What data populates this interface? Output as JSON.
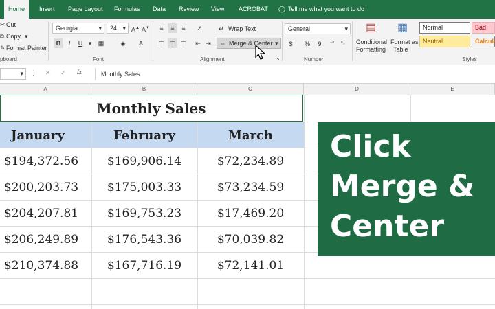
{
  "tabs": [
    "Home",
    "Insert",
    "Page Layout",
    "Formulas",
    "Data",
    "Review",
    "View",
    "ACROBAT"
  ],
  "tell_me": "Tell me what you want to do",
  "clipboard": {
    "cut": "Cut",
    "copy": "Copy",
    "format_painter": "Format Painter",
    "label": "pboard"
  },
  "font": {
    "name": "Georgia",
    "size": "24",
    "label": "Font",
    "bold": "B",
    "italic": "I",
    "underline": "U"
  },
  "alignment": {
    "wrap_text": "Wrap Text",
    "merge_center": "Merge & Center",
    "label": "Alignment"
  },
  "number": {
    "format": "General",
    "currency": "$",
    "percent": "%",
    "comma": "9",
    "label": "Number"
  },
  "styles_group": {
    "conditional_formatting": [
      "Conditional",
      "Formatting"
    ],
    "format_as_table": [
      "Format as",
      "Table"
    ],
    "label": "Styles",
    "normal": "Normal",
    "bad": "Bad",
    "neutral": "Neutral",
    "calculation": "Calcula"
  },
  "formula_bar": {
    "fx": "fx",
    "value": "Monthly Sales"
  },
  "columns": [
    "A",
    "B",
    "C",
    "D",
    "E"
  ],
  "sheet": {
    "title": "Monthly Sales",
    "headers": [
      "January",
      "February",
      "March"
    ],
    "rows": [
      [
        "$194,372.56",
        "$169,906.14",
        "$72,234.89"
      ],
      [
        "$200,203.73",
        "$175,003.33",
        "$73,234.59"
      ],
      [
        "$204,207.81",
        "$169,753.23",
        "$17,469.20"
      ],
      [
        "$206,249.89",
        "$176,543.36",
        "$70,039.82"
      ],
      [
        "$210,374.88",
        "$167,716.19",
        "$72,141.01"
      ]
    ]
  },
  "overlay": {
    "lines": [
      "Click",
      "Merge &",
      "Center"
    ]
  },
  "colors": {
    "excel_green": "#217346",
    "banner": "#1e6b44",
    "header_fill": "#c5d9f1"
  }
}
